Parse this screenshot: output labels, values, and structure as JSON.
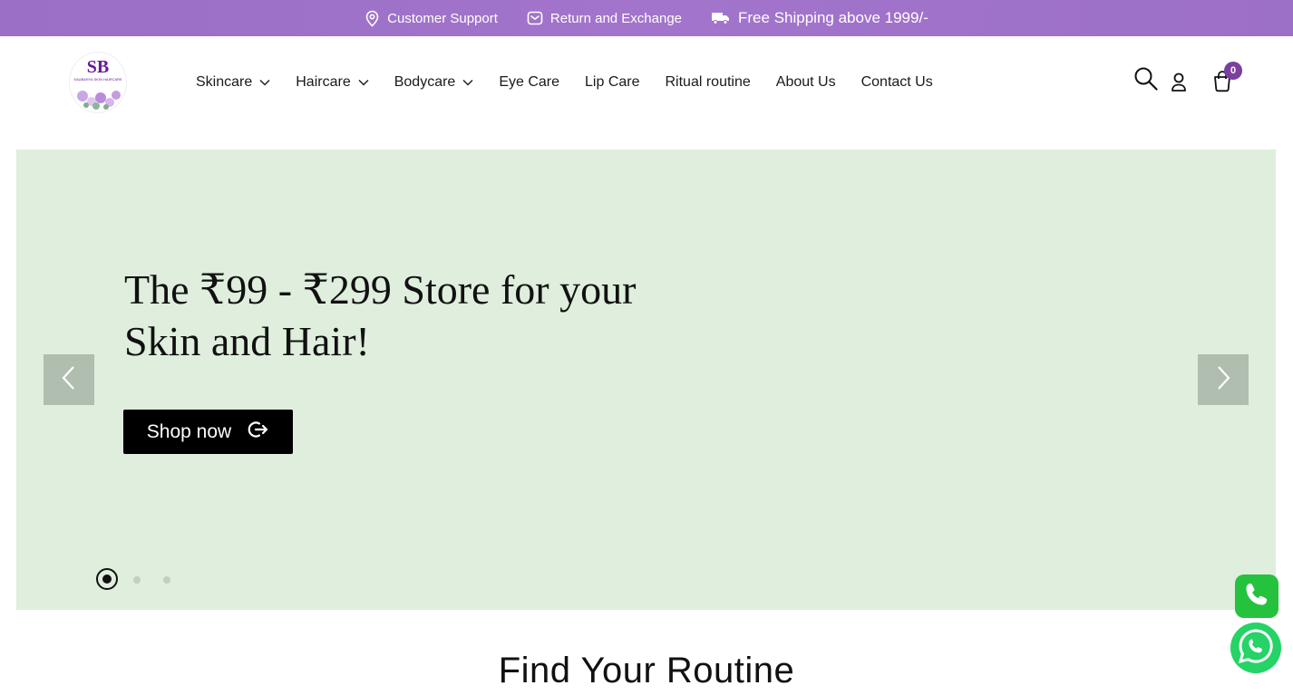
{
  "topbar": {
    "items": [
      {
        "label": "Customer Support",
        "icon": "location-pin-icon"
      },
      {
        "label": "Return and Exchange",
        "icon": "mail-icon"
      },
      {
        "label": "Free Shipping above 1999/-",
        "icon": "truck-icon"
      }
    ],
    "background": "#9b6fc6"
  },
  "header": {
    "logo": {
      "mark": "SB",
      "name": "SAUBARYA SKIN HAIRCARE"
    },
    "nav": [
      {
        "label": "Skincare",
        "has_dropdown": true
      },
      {
        "label": "Haircare",
        "has_dropdown": true
      },
      {
        "label": "Bodycare",
        "has_dropdown": true
      },
      {
        "label": "Eye Care",
        "has_dropdown": false
      },
      {
        "label": "Lip Care",
        "has_dropdown": false
      },
      {
        "label": "Ritual routine",
        "has_dropdown": false
      },
      {
        "label": "About Us",
        "has_dropdown": false
      },
      {
        "label": "Contact Us",
        "has_dropdown": false
      }
    ],
    "icons": [
      "search-icon",
      "user-icon",
      "cart-icon"
    ],
    "cart_count": "0",
    "accent": "#7b3fa0"
  },
  "hero": {
    "title_line1": "The ₹99 - ₹299 Store for your",
    "title_line2": "Skin and Hair!",
    "cta_label": "Shop now",
    "background": "#dfeedd",
    "slides_total": 3,
    "active_slide": 1
  },
  "section": {
    "title": "Find Your Routine"
  },
  "floating": {
    "call_icon": "phone-icon",
    "whatsapp_icon": "whatsapp-icon"
  }
}
